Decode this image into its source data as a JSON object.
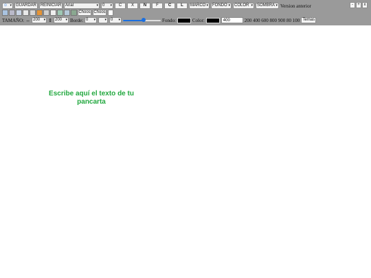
{
  "toolbar": {
    "icon_select_glyph": "☺",
    "guardar_label": "GUARDAR",
    "reiniciar_label": "REINICIAR",
    "font_value": "Arial",
    "font_size_value": "0",
    "btn_c": "C",
    "btn_x": "X",
    "btn_n": "N",
    "btn_f": "F",
    "btn_c2": "C",
    "btn_l": "L",
    "marco_label": "MARCO",
    "fondo_label": "FONDO",
    "color_label": "COLOR",
    "sombra_label": "SOMBRA",
    "version_label": "Version anterior",
    "choose_label_1": "Choos",
    "choose_label_2": "Choos",
    "window_controls": [
      "-",
      "+",
      "x"
    ],
    "swatches": [
      "#a9c3e0",
      "#b9b9c9",
      "#c8d3e4",
      "#e9e9e9",
      "#d6d6d6",
      "#e59436",
      "#cfcfcf",
      "#efefef",
      "#9ec8b4",
      "#b4c8d8",
      "#8aa890"
    ],
    "tamano_label": "TAMAÑO:",
    "width_icon": "⇔",
    "width_value": "200",
    "height_icon": "⇕",
    "height_value": "200",
    "borde_label": "Borde:",
    "borde_value": "0",
    "borde_style_value": "",
    "radius_value": "0",
    "slider_fraction": 0.55,
    "fondo_text_label": "Fondo:",
    "fondo_color": "#000000",
    "color_text_label": "Color:",
    "text_color": "#000000",
    "weight_input_value": "400",
    "weights_text": "200 400 600 800 900 80 100",
    "temas_label": "Temas"
  },
  "canvas": {
    "banner_text": "Escribe aquí el texto de tu pancarta",
    "banner_color": "#22a83f"
  }
}
